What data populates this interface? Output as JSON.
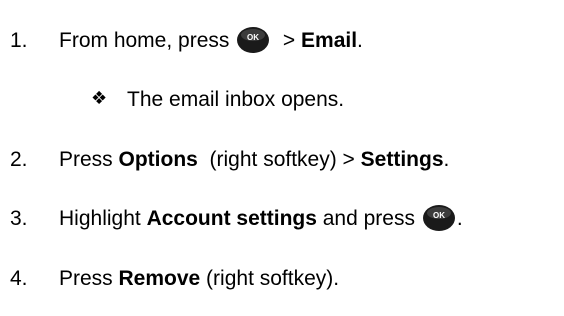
{
  "steps": [
    {
      "number": "1.",
      "pre": "From home, press",
      "icon": "ok-button-icon",
      "post_plain": " > ",
      "post_bold": "Email",
      "post_end": "."
    },
    {
      "number": "2.",
      "pre": "Press ",
      "bold1": "Options",
      "mid": "  (right softkey) > ",
      "bold2": "Settings",
      "end": "."
    },
    {
      "number": "3.",
      "pre": "Highlight ",
      "bold1": "Account settings",
      "mid": " and press",
      "icon": "ok-button-icon",
      "end": "."
    },
    {
      "number": "4.",
      "pre": "Press ",
      "bold1": "Remove",
      "end": " (right softkey)."
    }
  ],
  "sub_bullet": {
    "symbol": "❖",
    "text": "The email inbox opens."
  },
  "ok_icon": {
    "label": "OK",
    "fill": "#1a1a1a",
    "text_color": "#ffffff"
  }
}
